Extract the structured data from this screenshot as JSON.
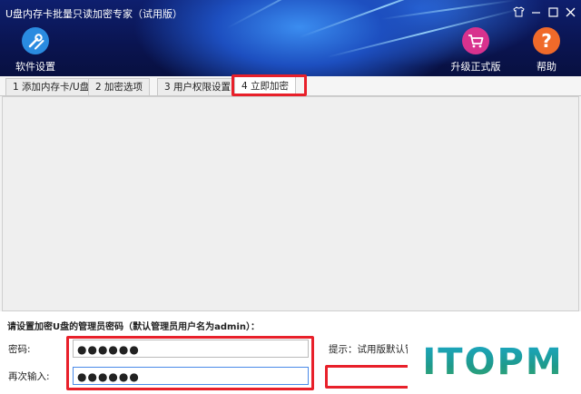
{
  "window": {
    "title": "U盘内存卡批量只读加密专家（试用版）"
  },
  "window_controls": [
    "skin",
    "minimize",
    "maximize",
    "close"
  ],
  "toolbar": {
    "settings_label": "软件设置",
    "upgrade_label": "升级正式版",
    "help_label": "帮助",
    "colors": {
      "settings": "#2a8be0",
      "upgrade": "#d8328e",
      "help": "#f06a2a"
    }
  },
  "tabs": [
    {
      "label": "1 添加内存卡/U盘",
      "active": false
    },
    {
      "label": "2 加密选项",
      "active": false
    },
    {
      "label": "3 用户权限设置",
      "active": false
    },
    {
      "label": "4 立即加密",
      "active": true
    }
  ],
  "form": {
    "prompt": "请设置加密U盘的管理员密码（默认管理员用户名为admin）：",
    "password_label": "密码:",
    "password_value": "●●●●●●",
    "confirm_label": "再次输入:",
    "confirm_value": "●●●●●●",
    "hint": "提示：试用版默认管理"
  },
  "watermark": "ITOPM",
  "accent": {
    "highlight": "#e8202a"
  }
}
